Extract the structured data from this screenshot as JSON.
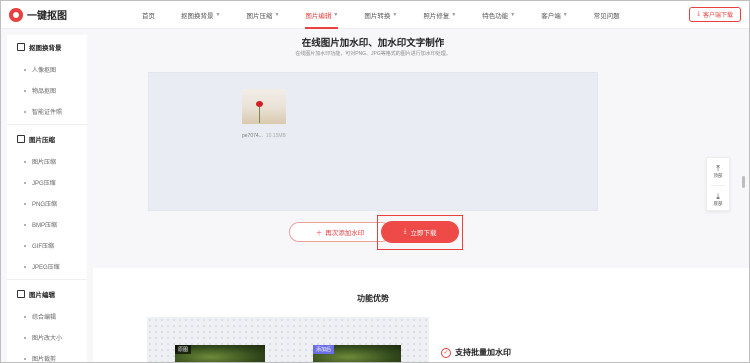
{
  "brand": {
    "name": "一键抠图",
    "accent": "#e8413f"
  },
  "nav": {
    "items": [
      {
        "label": "首页",
        "chev": false,
        "active": false
      },
      {
        "label": "抠图换背景",
        "chev": true,
        "active": false
      },
      {
        "label": "图片压缩",
        "chev": true,
        "active": false
      },
      {
        "label": "图片编辑",
        "chev": true,
        "active": true
      },
      {
        "label": "图片转换",
        "chev": true,
        "active": false
      },
      {
        "label": "照片修复",
        "chev": true,
        "active": false
      },
      {
        "label": "特色功能",
        "chev": true,
        "active": false
      },
      {
        "label": "客户端",
        "chev": true,
        "active": false
      },
      {
        "label": "常见问题",
        "chev": false,
        "active": false
      }
    ],
    "download_label": "客户端下载"
  },
  "sidebar": {
    "sections": [
      {
        "title": "抠图换背景",
        "items": [
          "人像抠图",
          "物品抠图",
          "智能证件照"
        ]
      },
      {
        "title": "图片压缩",
        "items": [
          "图片压缩",
          "JPG压缩",
          "PNG压缩",
          "BMP压缩",
          "GIF压缩",
          "JPEG压缩"
        ]
      },
      {
        "title": "图片编辑",
        "items": [
          "综合编辑",
          "图片改大小",
          "图片裁剪"
        ]
      }
    ]
  },
  "main": {
    "title": "在线图片加水印、加水印文字制作",
    "subtitle": "在线图片加水印功能，可对PNG、JPG等格式的图片进行加水印处理。",
    "file": {
      "name": "pe7074...",
      "size": "10.15MB"
    },
    "readd_label": "再次添加水印",
    "download_label": "立即下载"
  },
  "features": {
    "title": "功能优势",
    "tag_original": "原图",
    "tag_watermark": "添加后",
    "item1": "支持批量加水印"
  },
  "float": {
    "top_label": "顶部",
    "bottom_label": "底部"
  }
}
